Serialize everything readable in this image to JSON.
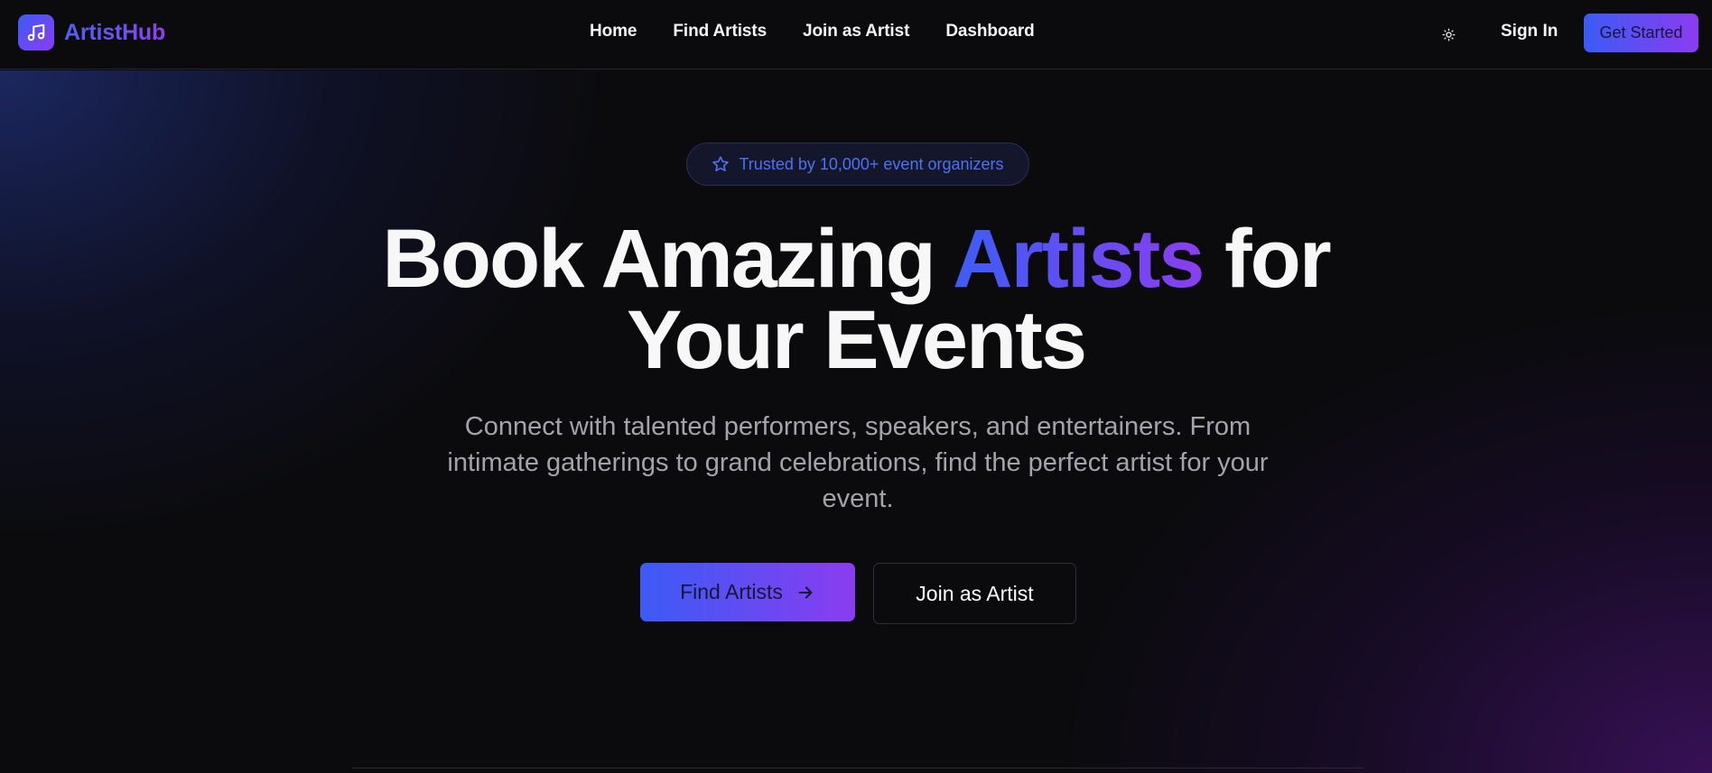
{
  "brand": {
    "name": "ArtistHub",
    "logo_icon": "music-note-icon"
  },
  "nav": {
    "links": [
      {
        "label": "Home"
      },
      {
        "label": "Find Artists"
      },
      {
        "label": "Join as Artist"
      },
      {
        "label": "Dashboard"
      }
    ],
    "theme_toggle_icon": "sun-icon",
    "sign_in": "Sign In",
    "get_started": "Get Started"
  },
  "hero": {
    "badge": {
      "icon": "star-icon",
      "text": "Trusted by 10,000+ event organizers"
    },
    "headline": {
      "part1": "Book Amazing ",
      "highlight": "Artists",
      "part2": " for",
      "line2": "Your Events"
    },
    "subtext": "Connect with talented performers, speakers, and entertainers. From intimate gatherings to grand celebrations, find the perfect artist for your event.",
    "primary_cta": "Find Artists",
    "secondary_cta": "Join as Artist"
  },
  "colors": {
    "accent_start": "#3b5bf5",
    "accent_end": "#8b3cf0",
    "background": "#0a0a0c",
    "badge_text": "#4d72f2"
  }
}
